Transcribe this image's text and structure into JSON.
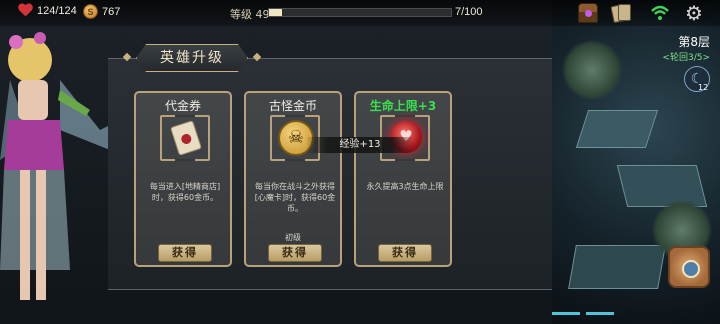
{
  "topbar": {
    "hp": "124/124",
    "gold": "767",
    "coin_symbol": "S",
    "level_label": "等级 49",
    "xp_fraction": 0.07,
    "xp_text": "7/100",
    "icons": [
      "heart-icon",
      "coin-icon",
      "chest-icon",
      "cards-icon",
      "wifi-icon",
      "gear-icon"
    ]
  },
  "map": {
    "floor": "第8层",
    "round": "<轮回3/5>",
    "moon_symbol": "☾",
    "moon_count": "12"
  },
  "panel": {
    "title": "英雄升级",
    "tooltip": "经验+13",
    "cards": [
      {
        "title": "代金券",
        "icon": "scroll-icon",
        "desc": "每当进入[地精商店]时，获得60金币。",
        "tier": "",
        "button": "获得"
      },
      {
        "title": "古怪金币",
        "icon": "skull-coin-icon",
        "icon_glyph": "☠",
        "desc": "每当你在战斗之外获得[心魔卡]时，获得60金币。",
        "tier": "初级",
        "button": "获得"
      },
      {
        "title": "生命上限+3",
        "icon": "heart-orb-icon",
        "icon_glyph": "♥",
        "desc": "永久提高3点生命上限",
        "tier": "",
        "button": "获得"
      }
    ]
  },
  "colors": {
    "accent_green": "#38e04c",
    "frame_gold": "#b9a27a",
    "round_green": "#7fe08a"
  }
}
